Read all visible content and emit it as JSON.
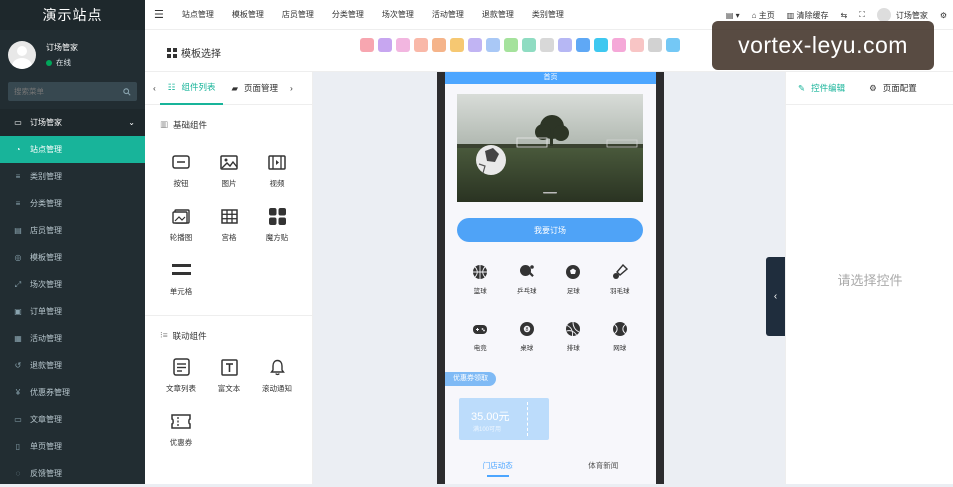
{
  "sidebar": {
    "brand": "演示站点",
    "user": {
      "name": "订场管家",
      "status": "在线"
    },
    "search_placeholder": "搜索菜单",
    "group_label": "订场管家",
    "items": [
      {
        "label": "站点管理",
        "icon": "dashboard-icon",
        "active": true
      },
      {
        "label": "类别管理",
        "icon": "list-icon"
      },
      {
        "label": "分类管理",
        "icon": "list-icon"
      },
      {
        "label": "店员管理",
        "icon": "id-card-icon"
      },
      {
        "label": "模板管理",
        "icon": "template-icon"
      },
      {
        "label": "场次管理",
        "icon": "clock-icon"
      },
      {
        "label": "订单管理",
        "icon": "order-icon"
      },
      {
        "label": "活动管理",
        "icon": "activity-icon"
      },
      {
        "label": "退款管理",
        "icon": "refund-icon"
      },
      {
        "label": "优惠券管理",
        "icon": "yen-icon"
      },
      {
        "label": "文章管理",
        "icon": "article-icon"
      },
      {
        "label": "单页管理",
        "icon": "page-icon"
      },
      {
        "label": "反馈管理",
        "icon": "chat-icon"
      }
    ]
  },
  "topbar": {
    "nav": [
      "站点管理",
      "模板管理",
      "店员管理",
      "分类管理",
      "场次管理",
      "活动管理",
      "退款管理",
      "类别管理"
    ],
    "home": "主页",
    "clear_cache": "清除缓存",
    "user": "订场管家"
  },
  "template": {
    "title": "模板选择",
    "swatches": [
      "#f7a6b0",
      "#c7a6f0",
      "#f2b6e0",
      "#f9b8a8",
      "#f5b48a",
      "#f6c872",
      "#c1b4f3",
      "#a9c8f6",
      "#a5e29c",
      "#8fdcc2",
      "#d8d8d8",
      "#b6b7f4",
      "#5fa8f5",
      "#3ec8f0",
      "#f5a8d8",
      "#f8c5c5",
      "#d2d2d2",
      "#74c8f5"
    ]
  },
  "left_panel": {
    "tabs": [
      "组件列表",
      "页面管理"
    ],
    "basic_title": "基础组件",
    "basic": [
      {
        "label": "按钮",
        "icon": "button-icon"
      },
      {
        "label": "图片",
        "icon": "image-icon"
      },
      {
        "label": "视频",
        "icon": "video-icon"
      },
      {
        "label": "轮播图",
        "icon": "carousel-icon"
      },
      {
        "label": "宫格",
        "icon": "grid-icon"
      },
      {
        "label": "魔方贴",
        "icon": "cube-icon"
      },
      {
        "label": "单元格",
        "icon": "cell-icon"
      }
    ],
    "linked_title": "联动组件",
    "linked": [
      {
        "label": "文章列表",
        "icon": "article-list-icon"
      },
      {
        "label": "富文本",
        "icon": "rich-text-icon"
      },
      {
        "label": "滚动通知",
        "icon": "bell-icon"
      },
      {
        "label": "优惠券",
        "icon": "coupon-icon"
      }
    ]
  },
  "phone": {
    "header": "首页",
    "book_button": "我要订场",
    "sports": [
      "篮球",
      "乒乓球",
      "足球",
      "羽毛球",
      "电竞",
      "桌球",
      "排球",
      "网球"
    ],
    "coupon_tag": "优惠券领取",
    "coupon_amount": "35.00元",
    "coupon_sub": "满100可用",
    "tabs": [
      "门店动态",
      "体育新闻"
    ]
  },
  "right_panel": {
    "tabs": [
      "控件编辑",
      "页面配置"
    ],
    "placeholder": "请选择控件"
  },
  "watermark": "vortex-leyu.com",
  "colors": {
    "accent": "#18b49a",
    "sidebar": "#222d32",
    "phone_primary": "#4fa3f7"
  }
}
